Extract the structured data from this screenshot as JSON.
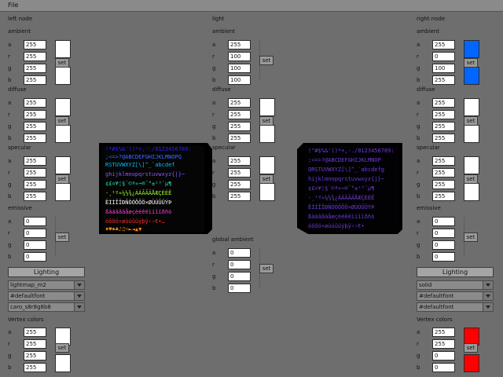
{
  "menubar": {
    "file": "File"
  },
  "left": {
    "title": "left node",
    "ambient": {
      "label": "ambient",
      "a": "255",
      "r": "255",
      "g": "255",
      "b": "255",
      "set": "set"
    },
    "diffuse": {
      "label": "diffuse",
      "a": "255",
      "r": "255",
      "g": "255",
      "b": "255",
      "set": "set"
    },
    "specular": {
      "label": "specular",
      "a": "255",
      "r": "255",
      "g": "255",
      "b": "255",
      "set": "set"
    },
    "emissive": {
      "label": "emissive",
      "a": "0",
      "r": "0",
      "g": "0",
      "b": "0",
      "set": "set"
    },
    "lighting": "Lighting",
    "selects": [
      "lightmap_m2",
      "#defaultfont",
      "caro_s8r8g8b8"
    ],
    "vertex": {
      "label": "Vertex colors",
      "a": "255",
      "r": "255",
      "g": "255",
      "b": "255",
      "set": "set"
    }
  },
  "light": {
    "title": "light",
    "ambient": {
      "label": "ambient",
      "a": "255",
      "r": "100",
      "g": "100",
      "b": "100",
      "set": "set"
    },
    "diffuse": {
      "label": "diffuse",
      "a": "255",
      "r": "255",
      "g": "255",
      "b": "255",
      "set": "set"
    },
    "specular": {
      "label": "specular",
      "a": "255",
      "r": "255",
      "g": "255",
      "b": "255",
      "set": "set"
    },
    "global": {
      "label": "global ambient",
      "a": "0",
      "r": "0",
      "g": "0",
      "b": "0",
      "set": "set"
    }
  },
  "right": {
    "title": "right node",
    "ambient": {
      "label": "ambient",
      "a": "255",
      "r": "0",
      "g": "100",
      "b": "255",
      "set": "set"
    },
    "diffuse": {
      "label": "diffuse",
      "a": "255",
      "r": "255",
      "g": "255",
      "b": "255",
      "set": "set"
    },
    "specular": {
      "label": "specular",
      "a": "255",
      "r": "255",
      "g": "255",
      "b": "255",
      "set": "set"
    },
    "emissive": {
      "label": "emissive",
      "a": "0",
      "r": "0",
      "g": "0",
      "b": "0",
      "set": "set"
    },
    "lighting": "Lighting",
    "selects": [
      "solid",
      "#defaultfont",
      "#defaultfont"
    ],
    "vertex": {
      "label": "Vertex colors",
      "a": "255",
      "r": "255",
      "g": "0",
      "b": "0",
      "set": "set"
    }
  },
  "scene": {
    "left_glyphs": "!\"#$%&'()*+,-./0123456789:;<=>?@ABCDEFGHIJKLMNOPQRSTUVWXYZ[\\]^_`abcdef",
    "right_glyphs": "!\"#$%&'()*+,-./0123456789:;<=>?@ABCDEFGHIJKLMNOPQRSTUVWXYZ[\\]^_`abcdefghijklmnopqr"
  },
  "colors": {
    "blue": "#0066ff",
    "red": "#ff0000",
    "white": "#ffffff"
  }
}
